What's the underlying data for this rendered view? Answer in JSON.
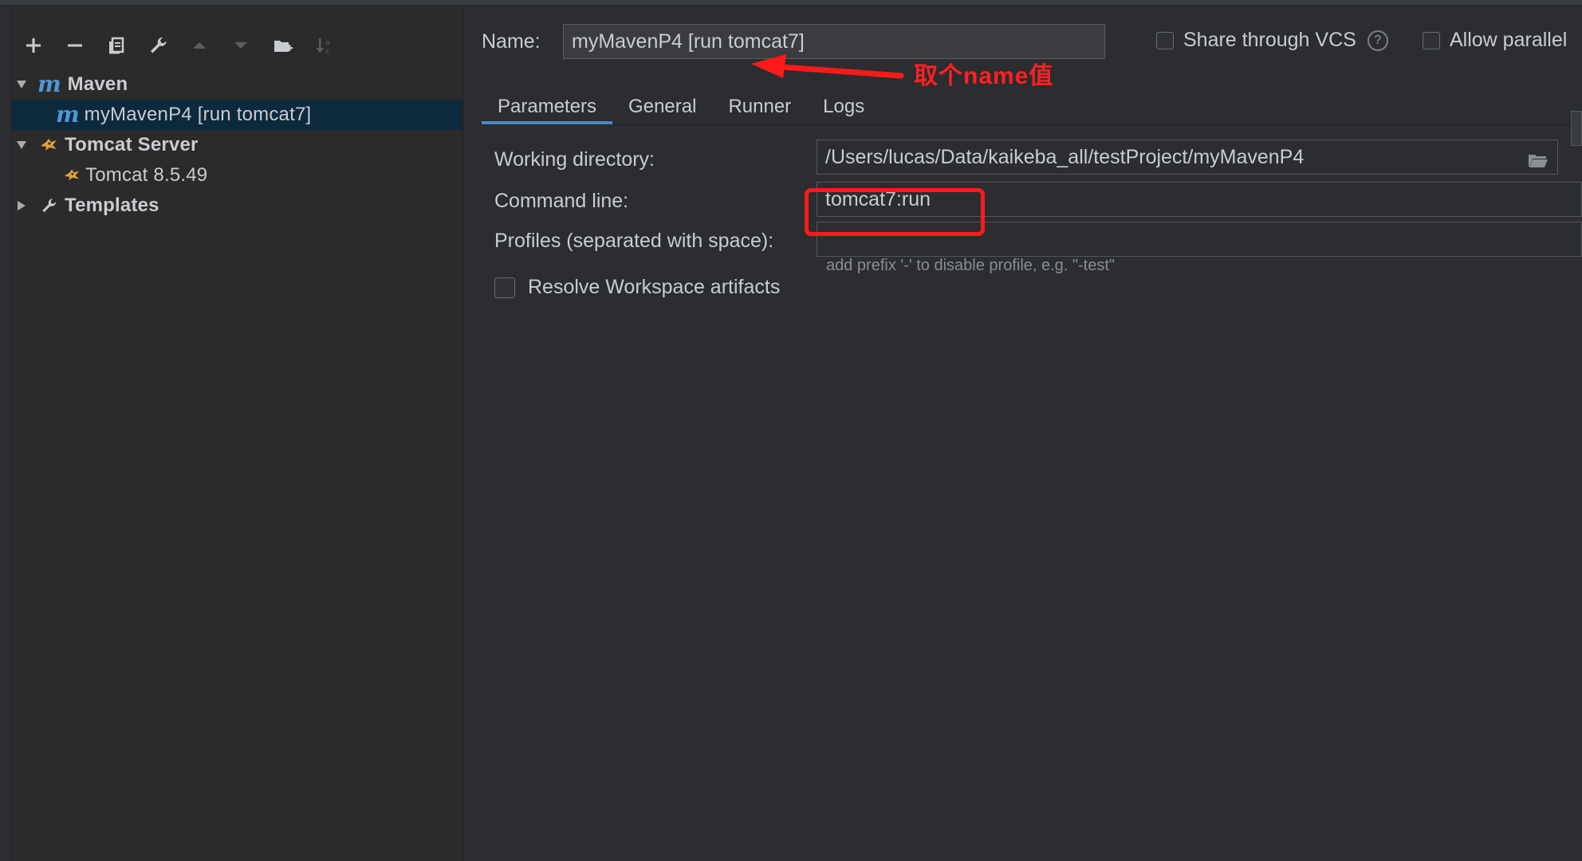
{
  "toolbar": {
    "add": "add-icon",
    "remove": "remove-icon",
    "copy": "copy-icon",
    "edit": "wrench-icon",
    "move_up": "arrow-up-icon",
    "move_down": "arrow-down-icon",
    "folder": "new-folder-icon",
    "sort": "sort-icon"
  },
  "tree": {
    "maven": {
      "icon_text": "m",
      "label": "Maven"
    },
    "maven_child": {
      "icon_text": "m",
      "label": "myMavenP4 [run tomcat7]"
    },
    "tomcat": {
      "label": "Tomcat Server"
    },
    "tomcat_child": {
      "label": "Tomcat 8.5.49"
    },
    "templates": {
      "label": "Templates"
    }
  },
  "header": {
    "name_label": "Name:",
    "name_value": "myMavenP4 [run tomcat7]",
    "share_label": "Share through VCS",
    "help_symbol": "?",
    "allow_label": "Allow parallel"
  },
  "tabs": [
    "Parameters",
    "General",
    "Runner",
    "Logs"
  ],
  "form": {
    "working_dir_label": "Working directory:",
    "working_dir_value": "/Users/lucas/Data/kaikeba_all/testProject/myMavenP4",
    "command_label": "Command line:",
    "command_value": "tomcat7:run",
    "profiles_label": "Profiles (separated with space):",
    "profiles_value": "",
    "profiles_hint": "add prefix '-' to disable profile, e.g. \"-test\"",
    "resolve_label": "Resolve Workspace artifacts"
  },
  "annotation": {
    "text": "取个name值",
    "color": "#ff2020"
  },
  "colors": {
    "accent": "#4a88c7",
    "selection": "#0d293e",
    "maven_icon": "#4f97d7"
  }
}
